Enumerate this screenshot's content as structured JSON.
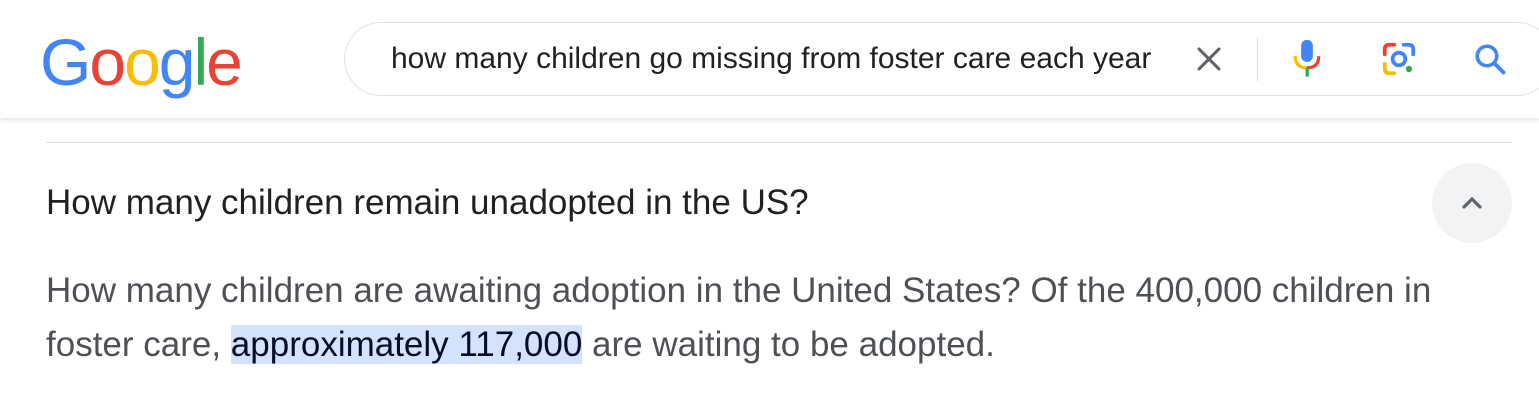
{
  "header": {
    "logo_letters": [
      {
        "char": "G",
        "color": "#4285F4"
      },
      {
        "char": "o",
        "color": "#EA4335"
      },
      {
        "char": "o",
        "color": "#FBBC05"
      },
      {
        "char": "g",
        "color": "#4285F4"
      },
      {
        "char": "l",
        "color": "#34A853"
      },
      {
        "char": "e",
        "color": "#EA4335"
      }
    ],
    "search": {
      "query": "how many children go missing from foster care each year"
    },
    "icons": {
      "clear": "close-icon",
      "mic": "microphone-icon",
      "lens": "google-lens-icon",
      "search": "search-icon"
    }
  },
  "faq": {
    "question": "How many children remain unadopted in the US?",
    "answer_before": "How many children are awaiting adoption in the United States? Of the 400,000 children in foster care, ",
    "answer_highlight": "approximately 117,000",
    "answer_after": " are waiting to be adopted.",
    "collapse_icon": "chevron-up-icon"
  },
  "colors": {
    "highlight_bg": "#d3e3fd",
    "text_primary": "#202124",
    "text_secondary": "#4d5156",
    "accent_blue": "#4285F4"
  }
}
